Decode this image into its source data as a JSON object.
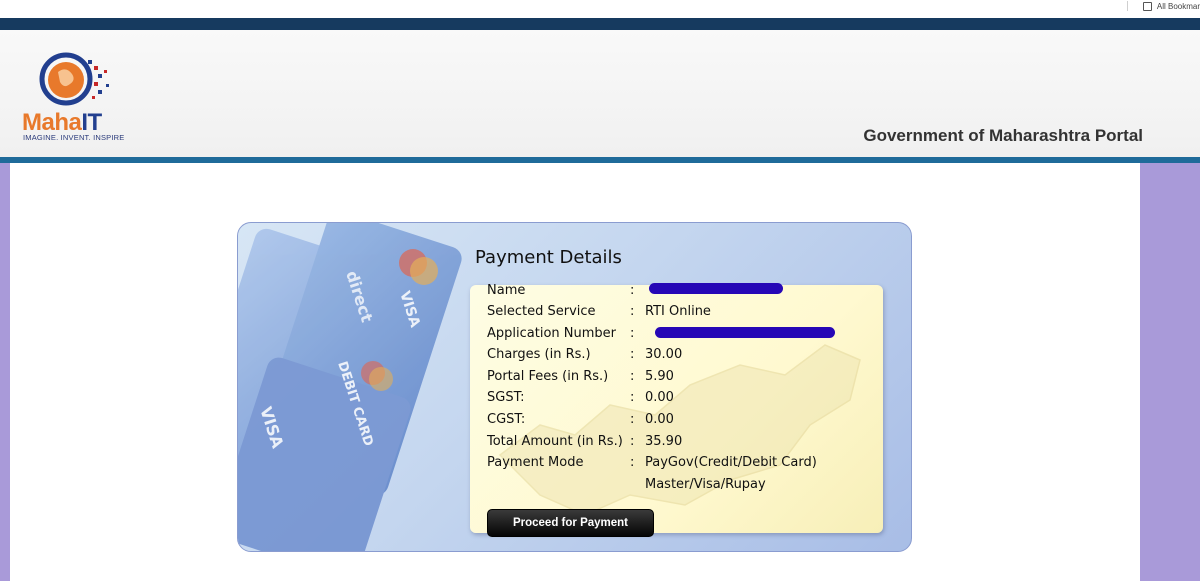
{
  "browser": {
    "bookmarks_label": "All Bookmar"
  },
  "header": {
    "logo_brand_main": "Maha",
    "logo_brand_accent": "IT",
    "logo_tagline": "IMAGINE. INVENT. INSPIRE",
    "portal_title": "Government of Maharashtra Portal"
  },
  "payment": {
    "title": "Payment Details",
    "rows": [
      {
        "label": "Name",
        "colon": ":",
        "value": ""
      },
      {
        "label": "Selected Service",
        "colon": ":",
        "value": "RTI Online"
      },
      {
        "label": "Application Number",
        "colon": ":",
        "value": ""
      },
      {
        "label": "Charges (in Rs.)",
        "colon": ":",
        "value": "30.00"
      },
      {
        "label": "Portal Fees (in Rs.)",
        "colon": ":",
        "value": "5.90"
      },
      {
        "label": "SGST:",
        "colon": ":",
        "value": "0.00"
      },
      {
        "label": "CGST:",
        "colon": ":",
        "value": "0.00"
      },
      {
        "label": "Total Amount (in Rs.)",
        "colon": ":",
        "value": "35.90"
      },
      {
        "label": "Payment Mode",
        "colon": ":",
        "value": "PayGov(Credit/Debit Card)"
      },
      {
        "label": "",
        "colon": "",
        "value": "Master/Visa/Rupay"
      }
    ],
    "proceed_label": "Proceed for Payment"
  },
  "card_art_text": {
    "direct": "direct",
    "visa_top": "VISA",
    "debit": "DEBIT CARD",
    "visa_bottom": "VISA"
  },
  "colors": {
    "header_band": "#163a5f",
    "accent_line": "#1f6b9a",
    "redaction": "#2607b6",
    "page_background": "#a99ad9"
  }
}
